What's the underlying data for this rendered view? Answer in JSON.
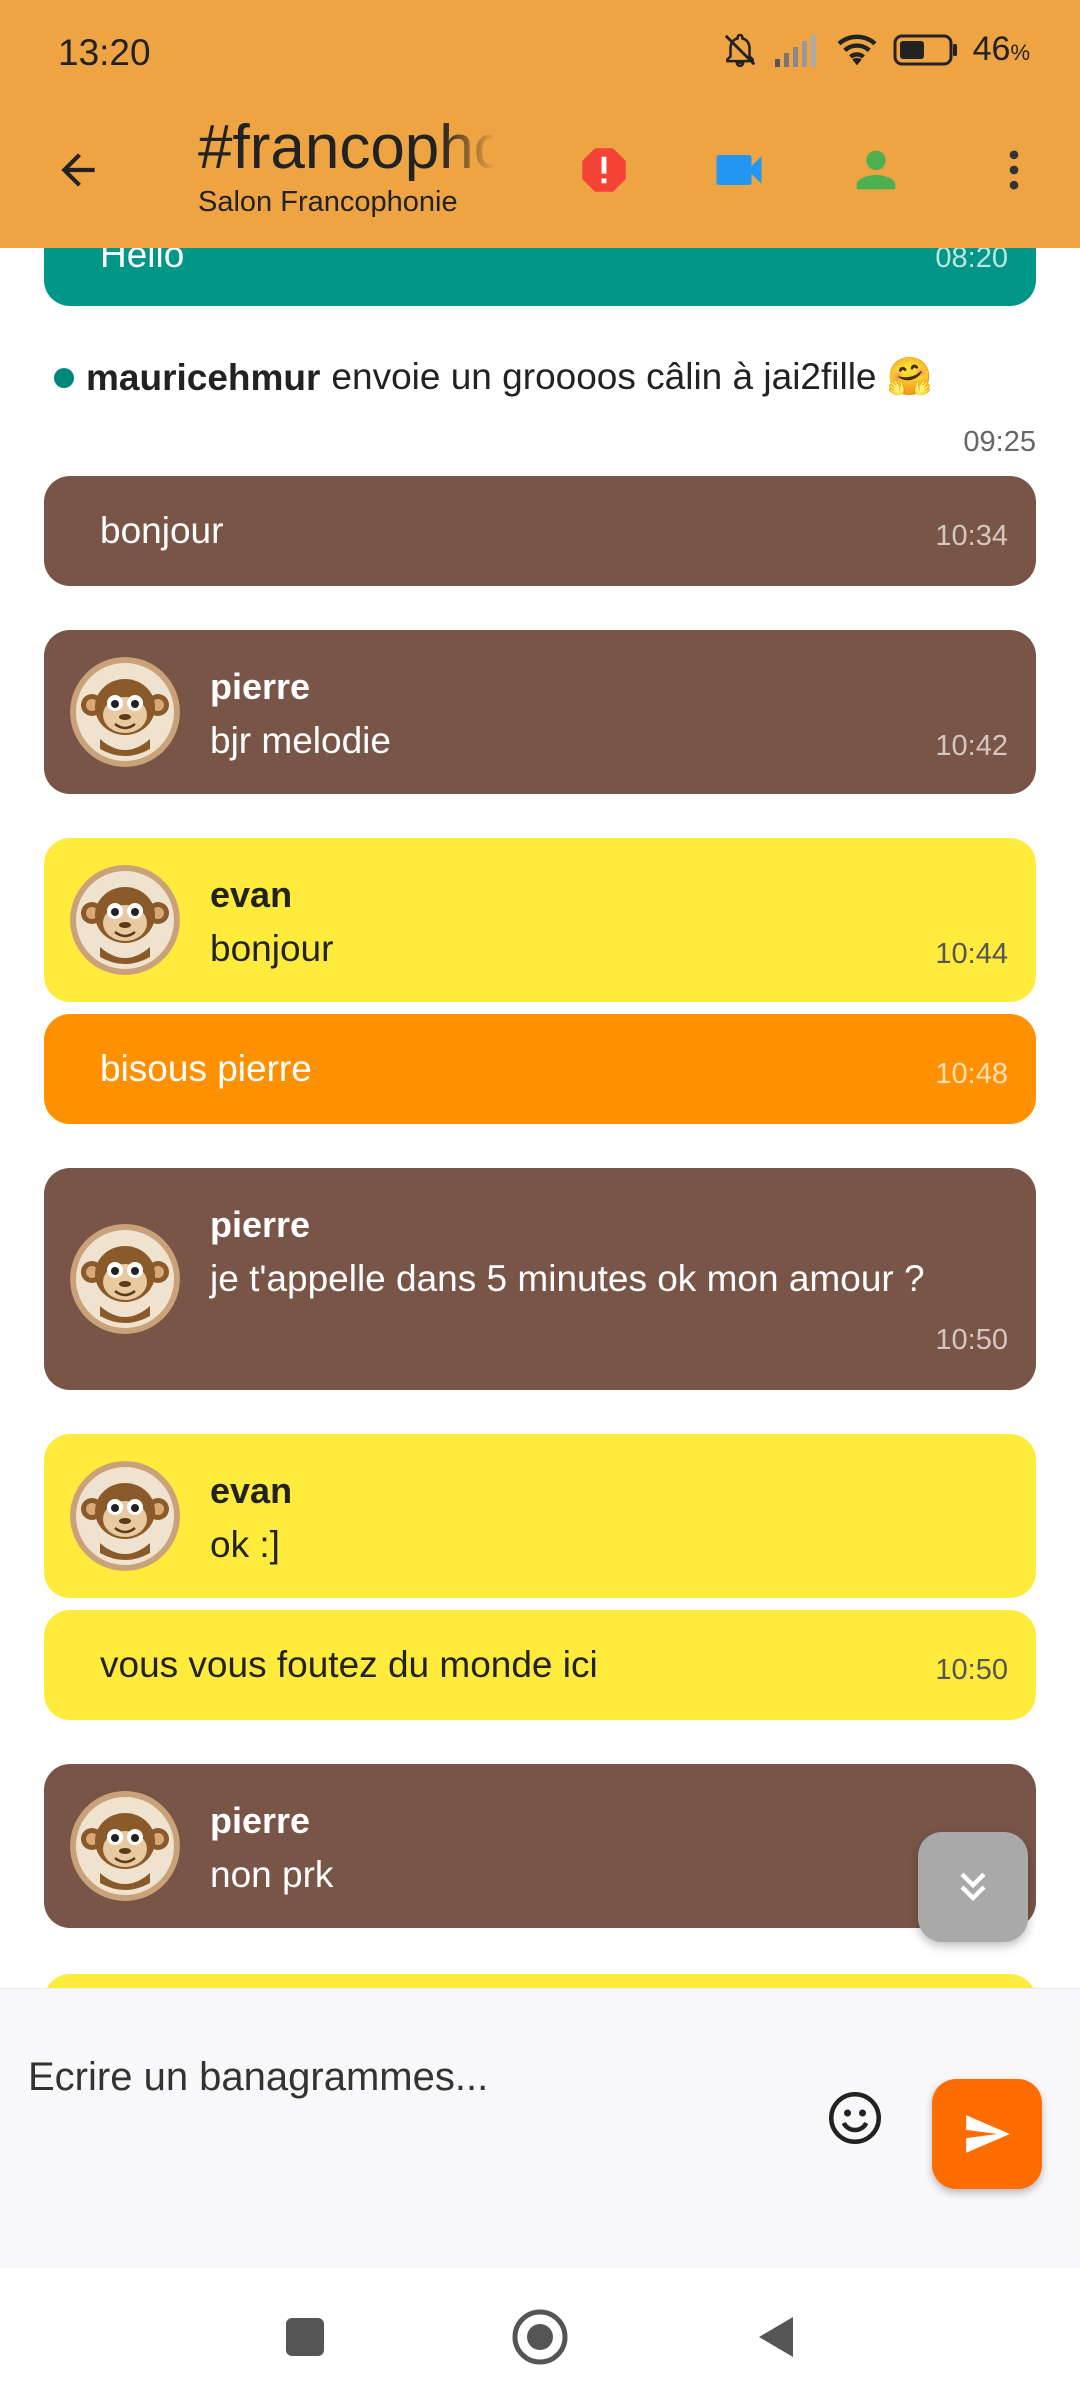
{
  "status_bar": {
    "time": "13:20",
    "battery_percent": "46",
    "battery_unit": "%"
  },
  "app_bar": {
    "title": "#francophonie",
    "subtitle": "Salon Francophonie"
  },
  "messages": [
    {
      "kind": "own",
      "color": "teal",
      "text": "Hello",
      "time": "08:20"
    },
    {
      "kind": "action",
      "user": "mauricehmur",
      "text": "envoie un groooos câlin à jai2fille 🤗",
      "time": "09:25"
    },
    {
      "kind": "own",
      "color": "brown",
      "text": "bonjour",
      "time": "10:34"
    },
    {
      "kind": "user",
      "color": "brown",
      "author": "pierre",
      "text": "bjr melodie",
      "time": "10:42"
    },
    {
      "kind": "user",
      "color": "yellow",
      "author": "evan",
      "text": "bonjour",
      "time": "10:44"
    },
    {
      "kind": "own",
      "color": "orange",
      "text": "bisous pierre",
      "time": "10:48"
    },
    {
      "kind": "user",
      "color": "brown",
      "author": "pierre",
      "text": "je t'appelle dans 5 minutes ok mon amour ?",
      "time": "10:50"
    },
    {
      "kind": "user",
      "color": "yellow",
      "author": "evan",
      "text": "ok :]",
      "time": ""
    },
    {
      "kind": "own",
      "color": "yellow",
      "text": "vous vous foutez du monde ici",
      "time": "10:50"
    },
    {
      "kind": "user",
      "color": "brown",
      "author": "pierre",
      "text": "non prk",
      "time": ""
    }
  ],
  "composer": {
    "placeholder": "Ecrire un banagrammes..."
  },
  "colors": {
    "header": "#EEA443",
    "brown": "#795548",
    "yellow": "#FFEB3B",
    "orange": "#FF9100",
    "teal": "#009688",
    "send": "#FF6D00",
    "alert": "#F44336",
    "video": "#2196F3",
    "person": "#4CAF50"
  }
}
